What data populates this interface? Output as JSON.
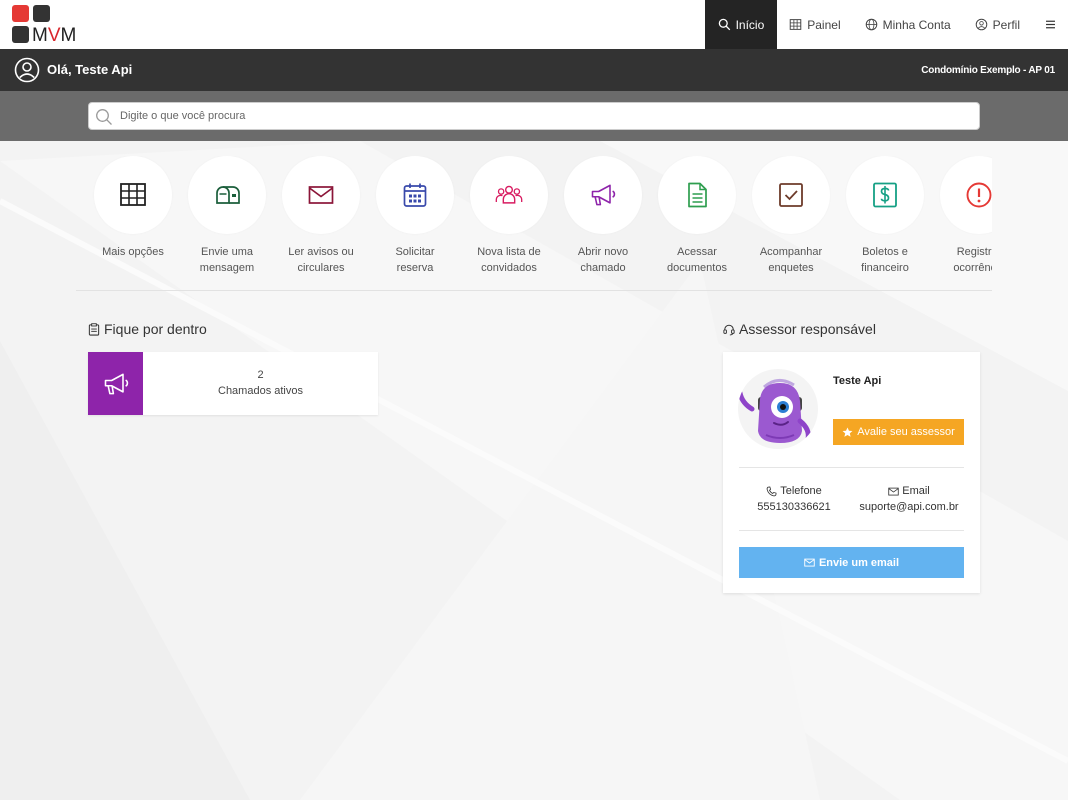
{
  "brand": {
    "logo_text_pre": "M",
    "logo_text_accent": "V",
    "logo_text_post": "M",
    "colors": {
      "red": "#e53935",
      "dark": "#333333",
      "accent": "#d9262c"
    }
  },
  "nav": {
    "items": [
      {
        "label": "Início",
        "icon": "search-icon",
        "active": true
      },
      {
        "label": "Painel",
        "icon": "grid-icon"
      },
      {
        "label": "Minha Conta",
        "icon": "globe-icon"
      },
      {
        "label": "Perfil",
        "icon": "user-circle-icon"
      }
    ],
    "menu_icon": "hamburger-icon"
  },
  "greeting": {
    "text": "Olá, Teste Api",
    "condo": "Condomínio Exemplo - AP 01"
  },
  "search": {
    "placeholder": "Digite o que você procura"
  },
  "actions": [
    {
      "line1": "Mais opções",
      "line2": "",
      "icon": "table-grid-icon",
      "color": "#222222"
    },
    {
      "line1": "Envie uma",
      "line2": "mensagem",
      "icon": "mailbox-icon",
      "color": "#1b5e3b"
    },
    {
      "line1": "Ler avisos ou",
      "line2": "circulares",
      "icon": "envelope-icon",
      "color": "#8b1538"
    },
    {
      "line1": "Solicitar",
      "line2": "reserva",
      "icon": "calendar-icon",
      "color": "#3949ab"
    },
    {
      "line1": "Nova lista de",
      "line2": "convidados",
      "icon": "group-icon",
      "color": "#d81b60"
    },
    {
      "line1": "Abrir novo",
      "line2": "chamado",
      "icon": "megaphone-icon",
      "color": "#8e24aa"
    },
    {
      "line1": "Acessar",
      "line2": "documentos",
      "icon": "document-icon",
      "color": "#2e9e4f"
    },
    {
      "line1": "Acompanhar",
      "line2": "enquetes",
      "icon": "checkbox-icon",
      "color": "#6d3b2a"
    },
    {
      "line1": "Boletos e",
      "line2": "financeiro",
      "icon": "dollar-icon",
      "color": "#16a085"
    },
    {
      "line1": "Registrar",
      "line2": "ocorrência",
      "icon": "alert-icon",
      "color": "#e53935"
    }
  ],
  "fique": {
    "title": "Fique por dentro",
    "card": {
      "count": "2",
      "label": "Chamados ativos",
      "color": "#8e24aa"
    }
  },
  "assessor": {
    "title": "Assessor responsável",
    "name": "Teste Api",
    "rate_label": "Avalie seu assessor",
    "phone_label": "Telefone",
    "phone": "555130336621",
    "email_label": "Email",
    "email": "suporte@api.com.br",
    "send_label": "Envie um email"
  }
}
